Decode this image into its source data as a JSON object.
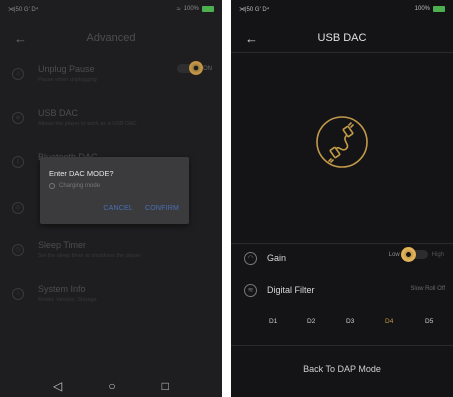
{
  "left": {
    "status": {
      "left": "⋊|50 G' D⁴",
      "wifi": "≈",
      "battery": "100%"
    },
    "title": "Advanced",
    "settings": [
      {
        "title": "Unplug Pause",
        "sub": "Pause when unplugging",
        "icon": "headphone-icon"
      },
      {
        "title": "USB DAC",
        "sub": "Allows the player to work as a USB DAC",
        "icon": "usb-icon"
      },
      {
        "title": "Bluetooth DAC",
        "sub": "",
        "icon": "bluetooth-icon"
      },
      {
        "title": "",
        "sub": "",
        "icon": "dac-icon"
      },
      {
        "title": "Sleep Timer",
        "sub": "Set the sleep timer to shutdown the player",
        "icon": "clock-icon"
      },
      {
        "title": "System Info",
        "sub": "Model, Version, Storage",
        "icon": "info-icon"
      }
    ],
    "toggle_label": "ON",
    "dialog": {
      "title": "Enter DAC MODE?",
      "option": "Charging mode",
      "cancel": "CANCEL",
      "confirm": "CONFIRM"
    },
    "nav": {
      "back": "◁",
      "home": "○",
      "recent": "□"
    }
  },
  "right": {
    "status": {
      "left": "⋊|50 G' D⁴",
      "battery": "100%"
    },
    "title": "USB DAC",
    "gain": {
      "label": "Gain",
      "low": "Low",
      "high": "High"
    },
    "filter": {
      "label": "Digital Filter",
      "value": "Slow Roll Off"
    },
    "filters": [
      "D1",
      "D2",
      "D3",
      "D4",
      "D5"
    ],
    "selected_filter": "D4",
    "back_button": "Back To DAP Mode"
  },
  "colors": {
    "accent": "#c39a48",
    "dialog_button": "#4a6fb3"
  }
}
